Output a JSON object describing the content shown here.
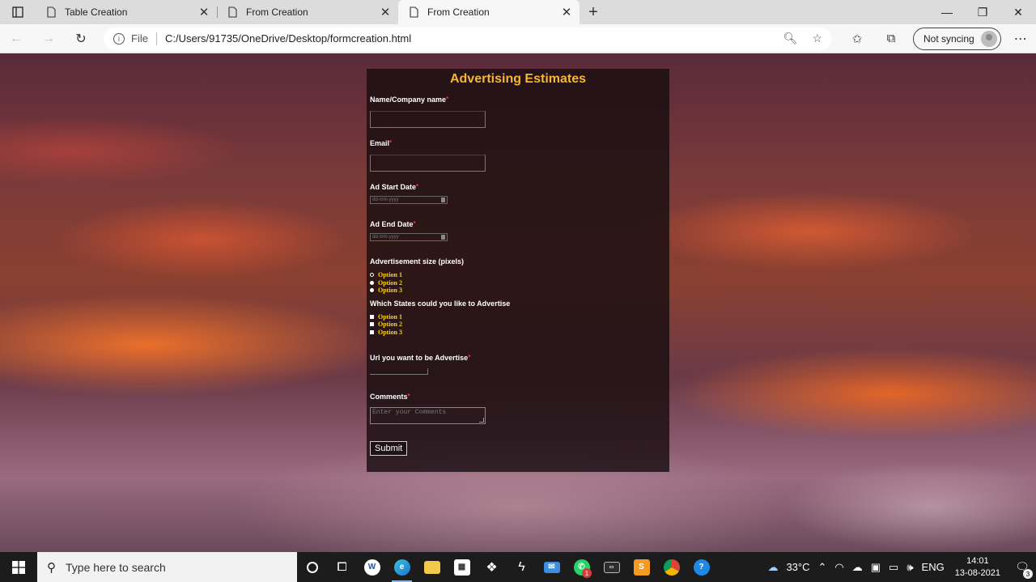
{
  "tabs": [
    {
      "title": "Table Creation",
      "active": false
    },
    {
      "title": "From Creation",
      "active": false
    },
    {
      "title": "From Creation",
      "active": true
    }
  ],
  "toolbar": {
    "file_label": "File",
    "url": "C:/Users/91735/OneDrive/Desktop/formcreation.html",
    "profile_label": "Not syncing"
  },
  "form": {
    "title": "Advertising Estimates",
    "name_label": "Name/Company name",
    "email_label": "Email",
    "start_date_label": "Ad Start Date",
    "start_date_placeholder": "dd-mm-yyyy",
    "end_date_label": "Ad End Date",
    "end_date_placeholder": "dd-mm-yyyy",
    "size_label": "Advertisement size (pixels)",
    "size_options": [
      "Option 1",
      "Option 2",
      "Option 3"
    ],
    "states_label": "Which States could you like to Advertise",
    "state_options": [
      "Option 1",
      "Option 2",
      "Option 3"
    ],
    "url_label": "Url you want to be Advertise",
    "comments_label": "Comments",
    "comments_placeholder": "Enter your Comments",
    "submit_label": "Submit",
    "required_mark": "*"
  },
  "taskbar": {
    "search_placeholder": "Type here to search",
    "weather": "33°C",
    "language": "ENG",
    "time": "14:01",
    "date": "13-08-2021",
    "whatsapp_badge": "1",
    "notifications_count": "3"
  },
  "colors": {
    "title_accent": "#f5b731",
    "option_text": "#ffd400",
    "required": "#ff3030"
  }
}
